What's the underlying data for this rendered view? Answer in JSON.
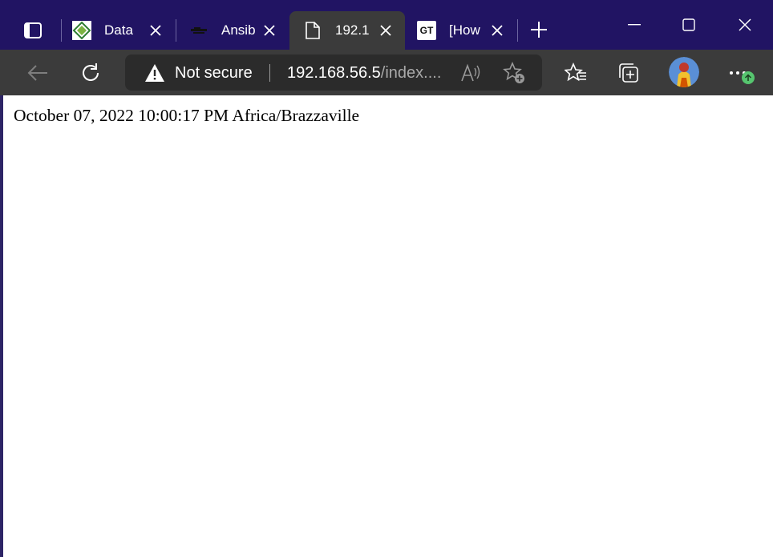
{
  "browser": {
    "tabs": [
      {
        "title": "Data :",
        "favicon": "green-logo-favicon",
        "active": false
      },
      {
        "title": "Ansib",
        "favicon": "ansible-dark-favicon",
        "active": false
      },
      {
        "title": "192.1",
        "favicon": "page-icon",
        "active": true
      },
      {
        "title": "[How",
        "favicon": "gt-favicon",
        "favicon_text": "GT",
        "active": false
      }
    ],
    "address_bar": {
      "security_label": "Not secure",
      "url_host": "192.168.56.5",
      "url_path": "/index...."
    },
    "colors": {
      "tabstrip_bg": "#211463",
      "toolbar_bg": "#3b3b3b",
      "update_badge": "#56c56f"
    }
  },
  "page": {
    "text": "October 07, 2022 10:00:17 PM Africa/Brazzaville"
  }
}
